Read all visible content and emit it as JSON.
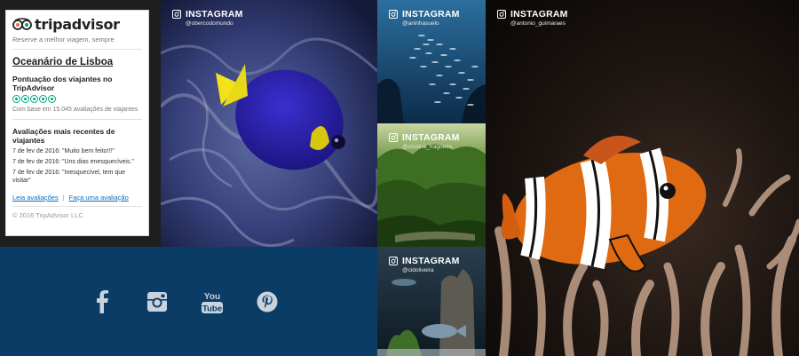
{
  "tripadvisor": {
    "logo_text": "tripadvisor",
    "tagline": "Reserve a melhor viagem, sempre",
    "place_name": "Oceanário de Lisboa",
    "score_heading": "Pontuação dos viajantes no TripAdvisor",
    "rating_bubbles": 5,
    "based_on": "Com base em 15.045 avaliações de viajantes",
    "recent_heading": "Avaliações mais recentes de viajantes",
    "reviews": [
      "7 de fev de 2016: \"Muito bem feito!!!\"",
      "7 de fev de 2016: \"Uns dias enesquecíveis.\"",
      "7 de fev de 2016: \"Inesquecível, tem que visitar\""
    ],
    "read_reviews_link": "Leia avaliações",
    "write_review_link": "Faça uma avaliação",
    "copyright": "© 2016 TripAdvisor LLC",
    "accent_color": "#00a680"
  },
  "social": {
    "background": "#0a3c66",
    "icons": [
      "facebook-icon",
      "instagram-icon",
      "youtube-icon",
      "pinterest-icon"
    ]
  },
  "instagram_tiles": [
    {
      "title": "INSTAGRAM",
      "user": "@obercodomundo"
    },
    {
      "title": "INSTAGRAM",
      "user": "@aninhasuelo"
    },
    {
      "title": "INSTAGRAM",
      "user": "@cristina_fragoeiro"
    },
    {
      "title": "INSTAGRAM",
      "user": "@cidoliveira"
    },
    {
      "title": "INSTAGRAM",
      "user": "@antonio_guimaraes"
    }
  ]
}
